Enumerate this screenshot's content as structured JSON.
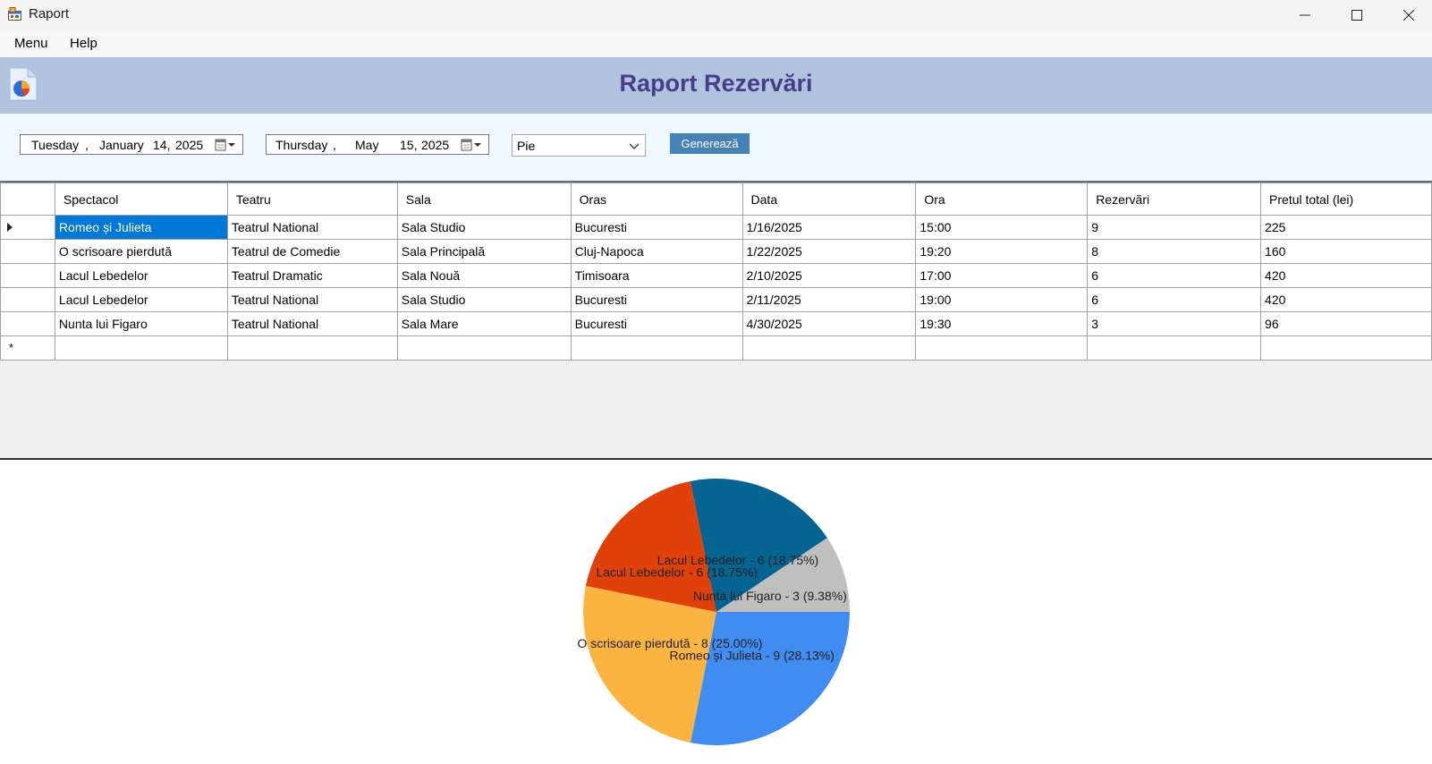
{
  "window": {
    "title": "Raport"
  },
  "menu": {
    "items": [
      "Menu",
      "Help"
    ]
  },
  "header": {
    "title": "Raport Rezervări"
  },
  "filters": {
    "start_date": {
      "weekday": "Tuesday",
      "month": "January",
      "day": "14,",
      "year": "2025"
    },
    "end_date": {
      "weekday": "Thursday",
      "month": "May",
      "day": "15,",
      "year": "2025"
    },
    "chart_type": "Pie",
    "generate_label": "Generează"
  },
  "table": {
    "columns": [
      "Spectacol",
      "Teatru",
      "Sala",
      "Oras",
      "Data",
      "Ora",
      "Rezervări",
      "Pretul total (lei)"
    ],
    "rows": [
      [
        "Romeo și Julieta",
        "Teatrul National",
        "Sala Studio",
        "Bucuresti",
        "1/16/2025",
        "15:00",
        "9",
        "225"
      ],
      [
        "O scrisoare pierdută",
        "Teatrul de Comedie",
        "Sala Principală",
        "Cluj-Napoca",
        "1/22/2025",
        "19:20",
        "8",
        "160"
      ],
      [
        "Lacul Lebedelor",
        "Teatrul Dramatic",
        "Sala Nouă",
        "Timisoara",
        "2/10/2025",
        "17:00",
        "6",
        "420"
      ],
      [
        "Lacul Lebedelor",
        "Teatrul National",
        "Sala Studio",
        "Bucuresti",
        "2/11/2025",
        "19:00",
        "6",
        "420"
      ],
      [
        "Nunta lui Figaro",
        "Teatrul National",
        "Sala Mare",
        "Bucuresti",
        "4/30/2025",
        "19:30",
        "3",
        "96"
      ]
    ],
    "new_row_marker": "*"
  },
  "colors": {
    "header_bg": "#b0c4de",
    "header_title": "#483d8b",
    "filter_bg": "#f0f8ff",
    "button_bg": "#4682b4",
    "selection": "#0078d7"
  },
  "chart_data": {
    "type": "pie",
    "slices": [
      {
        "label": "Romeo și Julieta - 9 (28.13%)",
        "value": 9,
        "color": "#418cf0"
      },
      {
        "label": "O scrisoare pierdută - 8 (25.00%)",
        "value": 8,
        "color": "#fcb441"
      },
      {
        "label": "Lacul Lebedelor - 6 (18.75%)",
        "value": 6,
        "color": "#e0400a"
      },
      {
        "label": "Lacul Lebedelor - 6 (18.75%)",
        "value": 6,
        "color": "#056492"
      },
      {
        "label": "Nunta lui Figaro - 3 (9.38%)",
        "value": 3,
        "color": "#bfbfbf"
      }
    ]
  }
}
